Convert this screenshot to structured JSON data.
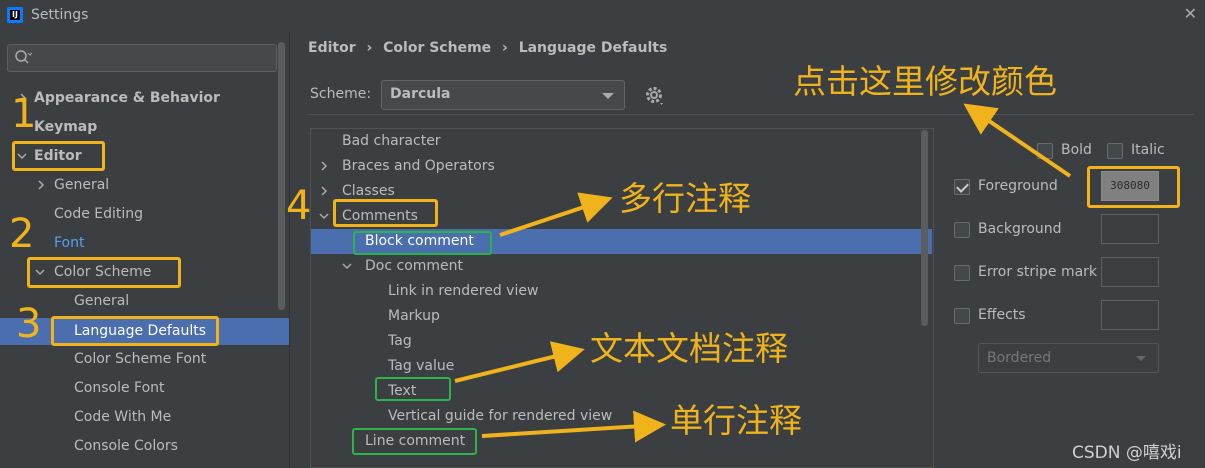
{
  "window": {
    "title": "Settings",
    "app_icon": "IJ"
  },
  "search": {
    "placeholder": ""
  },
  "sidebar": {
    "items": [
      {
        "label": "Appearance & Behavior",
        "expanded": false
      },
      {
        "label": "Keymap"
      },
      {
        "label": "Editor",
        "expanded": true
      },
      {
        "label": "General",
        "expanded": false
      },
      {
        "label": "Code Editing"
      },
      {
        "label": "Font"
      },
      {
        "label": "Color Scheme",
        "expanded": true
      },
      {
        "label": "General"
      },
      {
        "label": "Language Defaults",
        "selected": true
      },
      {
        "label": "Color Scheme Font"
      },
      {
        "label": "Console Font"
      },
      {
        "label": "Code With Me"
      },
      {
        "label": "Console Colors"
      }
    ]
  },
  "breadcrumb": {
    "items": [
      "Editor",
      "Color Scheme",
      "Language Defaults"
    ],
    "separator": "›"
  },
  "scheme": {
    "label": "Scheme:",
    "value": "Darcula"
  },
  "attributes": {
    "items": [
      {
        "label": "Bad character"
      },
      {
        "label": "Braces and Operators"
      },
      {
        "label": "Classes"
      },
      {
        "label": "Comments"
      },
      {
        "label": "Block comment",
        "selected": true
      },
      {
        "label": "Doc comment"
      },
      {
        "label": "Link in rendered view"
      },
      {
        "label": "Markup"
      },
      {
        "label": "Tag"
      },
      {
        "label": "Tag value"
      },
      {
        "label": "Text"
      },
      {
        "label": "Vertical guide for rendered view"
      },
      {
        "label": "Line comment"
      }
    ]
  },
  "options": {
    "bold": "Bold",
    "italic": "Italic",
    "foreground": "Foreground",
    "foreground_value": "808080",
    "foreground_display": "308080",
    "background": "Background",
    "error_stripe": "Error stripe mark",
    "effects": "Effects",
    "effects_type": "Bordered"
  },
  "annotations": {
    "steps": [
      "1",
      "2",
      "3",
      "4"
    ],
    "change_color": "点击这里修改颜色",
    "block_comment": "多行注释",
    "doc_comment": "文本文档注释",
    "line_comment": "单行注释"
  },
  "watermark": "CSDN @嘻戏i",
  "colors": {
    "background": "#3c3f41",
    "selection": "#4b6eaf",
    "link": "#589df6",
    "annotation": "#f0b31c",
    "highlight_green": "#2db34a"
  }
}
